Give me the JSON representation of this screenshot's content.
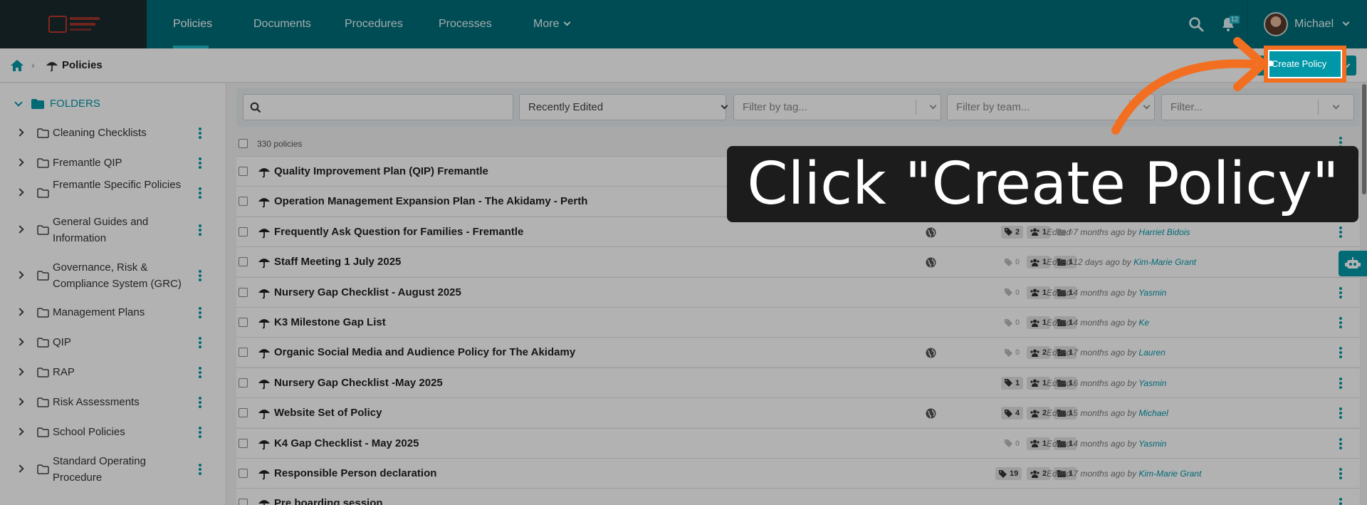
{
  "nav": {
    "items": [
      {
        "label": "Policies"
      },
      {
        "label": "Documents"
      },
      {
        "label": "Procedures"
      },
      {
        "label": "Processes"
      },
      {
        "label": "More"
      }
    ],
    "notification_count": "12",
    "user_name": "Michael"
  },
  "breadcrumb": {
    "current": "Policies"
  },
  "toolbar": {
    "create_label": "Create Policy"
  },
  "sidebar": {
    "heading": "FOLDERS",
    "items": [
      {
        "label": "Cleaning Checklists"
      },
      {
        "label": "Fremantle QIP"
      },
      {
        "label": "Fremantle Specific Policies"
      },
      {
        "label": "General Guides and Information"
      },
      {
        "label": "Governance, Risk & Compliance System (GRC)"
      },
      {
        "label": "Management Plans"
      },
      {
        "label": "QIP"
      },
      {
        "label": "RAP"
      },
      {
        "label": "Risk Assessments"
      },
      {
        "label": "School Policies"
      },
      {
        "label": "Standard Operating Procedure"
      }
    ]
  },
  "filters": {
    "search_placeholder": "",
    "sort_value": "Recently Edited",
    "tag_placeholder": "Filter by tag...",
    "team_placeholder": "Filter by team...",
    "other_placeholder": "Filter..."
  },
  "list": {
    "count_text": "330 policies",
    "rows": [
      {
        "title": "Quality Improvement Plan (QIP) Fremantle"
      },
      {
        "title": "Operation Management Expansion Plan - The Akidamy - Perth"
      },
      {
        "title": "Frequently Ask Question for Families - Fremantle",
        "globe": true,
        "tags": "2",
        "teams": "1",
        "folders": "0",
        "edited_prefix": "Edited 7 months ago by ",
        "editor": "Harriet Bidois"
      },
      {
        "title": "Staff Meeting 1 July 2025",
        "globe": true,
        "tags": "0",
        "teams": "1",
        "folders": "1",
        "edited_prefix": "Edited 12 days ago by ",
        "editor": "Kim-Marie Grant"
      },
      {
        "title": "Nursery Gap Checklist - August 2025",
        "globe": false,
        "tags": "0",
        "teams": "1",
        "folders": "1",
        "edited_prefix": "Edited 4 months ago by ",
        "editor": "Yasmin"
      },
      {
        "title": "K3 Milestone Gap List",
        "globe": false,
        "tags": "0",
        "teams": "1",
        "folders": "1",
        "edited_prefix": "Edited 4 months ago by ",
        "editor": "Ke"
      },
      {
        "title": "Organic Social Media and Audience Policy for The Akidamy",
        "globe": true,
        "tags": "0",
        "teams": "2",
        "folders": "1",
        "edited_prefix": "Edited 7 months ago by ",
        "editor": "Lauren"
      },
      {
        "title": "Nursery Gap Checklist -May 2025",
        "globe": false,
        "tags": "1",
        "teams": "1",
        "folders": "1",
        "edited_prefix": "Edited 6 months ago by ",
        "editor": "Yasmin"
      },
      {
        "title": "Website Set of Policy",
        "globe": true,
        "tags": "4",
        "teams": "2",
        "folders": "1",
        "edited_prefix": "Edited 5 months ago by ",
        "editor": "Michael"
      },
      {
        "title": "K4 Gap Checklist - May 2025",
        "globe": false,
        "tags": "0",
        "teams": "1",
        "folders": "1",
        "edited_prefix": "Edited 4 months ago by ",
        "editor": "Yasmin"
      },
      {
        "title": "Responsible Person declaration",
        "globe": false,
        "tags": "19",
        "teams": "2",
        "folders": "1",
        "edited_prefix": "Edited 7 months ago by ",
        "editor": "Kim-Marie Grant"
      },
      {
        "title": "Pre boarding session"
      }
    ]
  },
  "overlay": {
    "instruction": "Click \"Create Policy\""
  },
  "colors": {
    "nav_bg": "#006d7a",
    "accent": "#0098a8",
    "highlight": "#f26f21"
  }
}
